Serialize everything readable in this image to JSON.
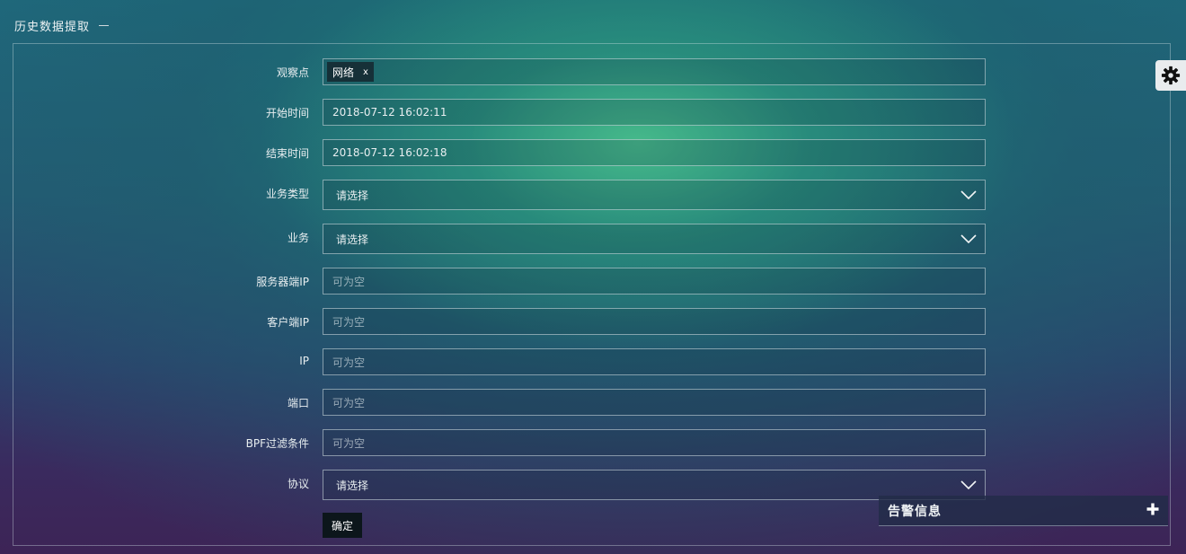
{
  "page": {
    "title": "历史数据提取"
  },
  "form": {
    "observation_point": {
      "label": "观察点",
      "tags": [
        "网络"
      ],
      "tag_remove": "x"
    },
    "start_time": {
      "label": "开始时间",
      "value": "2018-07-12 16:02:11"
    },
    "end_time": {
      "label": "结束时间",
      "value": "2018-07-12 16:02:18"
    },
    "business_type": {
      "label": "业务类型",
      "selected": "请选择"
    },
    "business": {
      "label": "业务",
      "selected": "请选择"
    },
    "server_ip": {
      "label": "服务器端IP",
      "placeholder": "可为空"
    },
    "client_ip": {
      "label": "客户端IP",
      "placeholder": "可为空"
    },
    "ip": {
      "label": "IP",
      "placeholder": "可为空"
    },
    "port": {
      "label": "端口",
      "placeholder": "可为空"
    },
    "bpf_filter": {
      "label": "BPF过滤条件",
      "placeholder": "可为空"
    },
    "protocol": {
      "label": "协议",
      "selected": "请选择"
    },
    "submit_label": "确定"
  },
  "alarm_panel": {
    "title": "告警信息"
  },
  "icons": {
    "settings": "gear-icon",
    "expand": "plus-icon",
    "dropdown": "chevron-down-icon"
  }
}
